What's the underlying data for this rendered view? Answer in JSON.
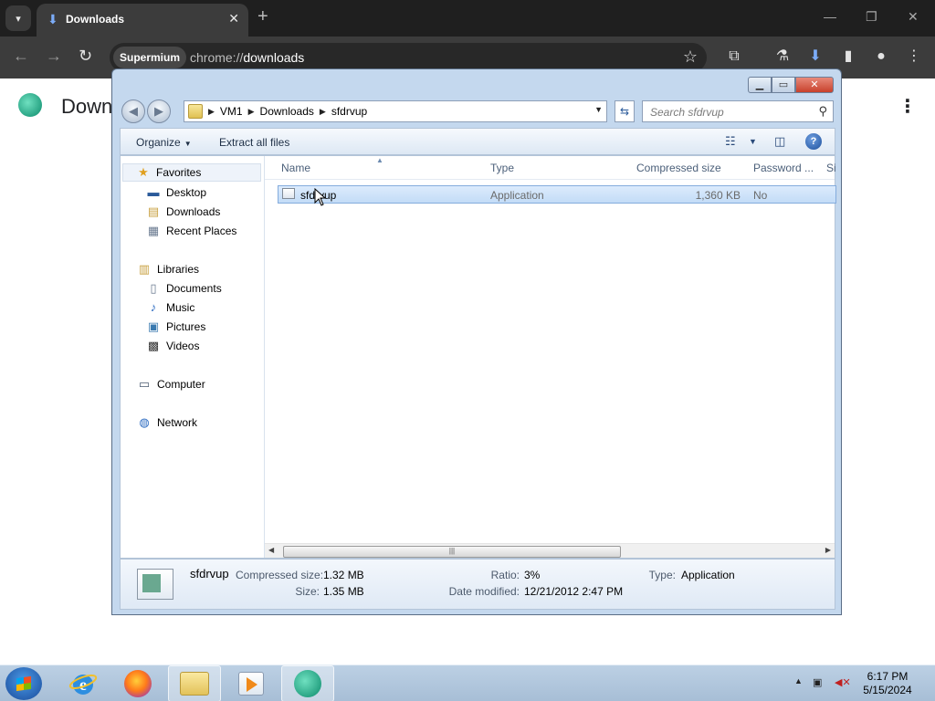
{
  "browser": {
    "tab_title": "Downloads",
    "profile_chip": "Supermium",
    "url_prefix": "chrome://",
    "url_path": "downloads",
    "page_title": "Downl"
  },
  "explorer": {
    "breadcrumbs": [
      "VM1",
      "Downloads",
      "sfdrvup"
    ],
    "search_placeholder": "Search sfdrvup",
    "commands": {
      "organize": "Organize",
      "extract": "Extract all files"
    },
    "nav": {
      "favorites": "Favorites",
      "desktop": "Desktop",
      "downloads": "Downloads",
      "recent": "Recent Places",
      "libraries": "Libraries",
      "documents": "Documents",
      "music": "Music",
      "pictures": "Pictures",
      "videos": "Videos",
      "computer": "Computer",
      "network": "Network"
    },
    "columns": {
      "name": "Name",
      "type": "Type",
      "compressed": "Compressed size",
      "password": "Password ...",
      "size": "Si"
    },
    "rows": [
      {
        "name": "sfdrvup",
        "type": "Application",
        "compressed": "1,360 KB",
        "password": "No"
      }
    ],
    "details": {
      "name": "sfdrvup",
      "compressed_label": "Compressed size:",
      "compressed_value": "1.32 MB",
      "size_label": "Size:",
      "size_value": "1.35 MB",
      "ratio_label": "Ratio:",
      "ratio_value": "3%",
      "modified_label": "Date modified:",
      "modified_value": "12/21/2012 2:47 PM",
      "type_label": "Type:",
      "type_value": "Application"
    }
  },
  "taskbar": {
    "time": "6:17 PM",
    "date": "5/15/2024"
  },
  "colors": {
    "chrome_dark": "#1f1f1f",
    "selection": "#c3dcf7",
    "taskbar": "#a7bed6"
  }
}
